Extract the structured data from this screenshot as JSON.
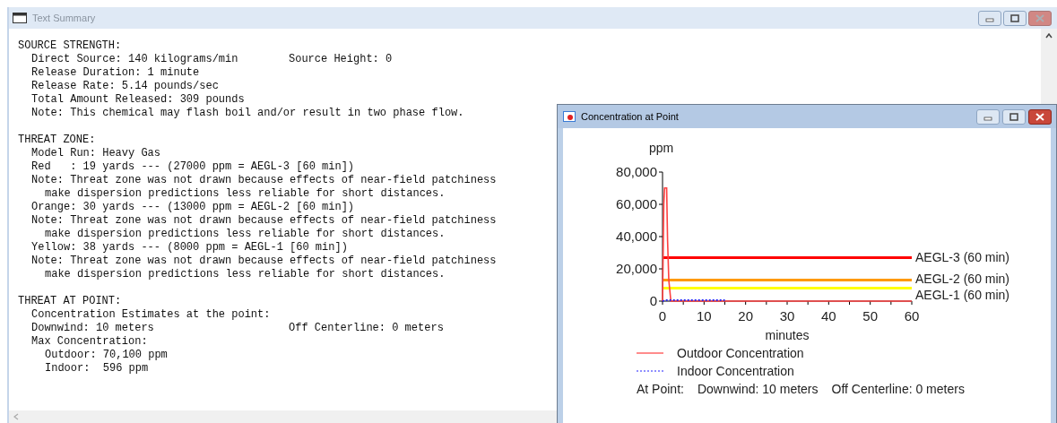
{
  "summary_window": {
    "title": "Text Summary",
    "sections": [
      {
        "heading": "SOURCE STRENGTH:",
        "items": [
          {
            "text": "Direct Source: 140 kilograms/min",
            "aside": "Source Height: 0"
          },
          {
            "text": "Release Duration: 1 minute"
          },
          {
            "text": "Release Rate: 5.14 pounds/sec"
          },
          {
            "text": "Total Amount Released: 309 pounds"
          },
          {
            "text": "Note: This chemical may flash boil and/or result in two phase flow."
          }
        ]
      },
      {
        "heading": "THREAT ZONE:",
        "items": [
          {
            "text": "Model Run: Heavy Gas"
          },
          {
            "text": "Red   : 19 yards --- (27000 ppm = AEGL-3 [60 min])"
          },
          {
            "text": "Note: Threat zone was not drawn because effects of near-field patchiness",
            "children": [
              {
                "text": "make dispersion predictions less reliable for short distances."
              }
            ]
          },
          {
            "text": "Orange: 30 yards --- (13000 ppm = AEGL-2 [60 min])"
          },
          {
            "text": "Note: Threat zone was not drawn because effects of near-field patchiness",
            "children": [
              {
                "text": "make dispersion predictions less reliable for short distances."
              }
            ]
          },
          {
            "text": "Yellow: 38 yards --- (8000 ppm = AEGL-1 [60 min])"
          },
          {
            "text": "Note: Threat zone was not drawn because effects of near-field patchiness",
            "children": [
              {
                "text": "make dispersion predictions less reliable for short distances."
              }
            ]
          }
        ]
      },
      {
        "heading": "THREAT AT POINT:",
        "items": [
          {
            "text": "Concentration Estimates at the point:"
          },
          {
            "text": "Downwind: 10 meters",
            "aside": "Off Centerline: 0 meters"
          },
          {
            "text": "Max Concentration:",
            "children": [
              {
                "text": "Outdoor: 70,100 ppm"
              },
              {
                "text": "Indoor:  596 ppm"
              }
            ]
          }
        ]
      }
    ]
  },
  "chart_window": {
    "title": "Concentration at Point",
    "chart_data": {
      "type": "line",
      "xlabel": "minutes",
      "ylabel": "ppm",
      "x": [
        0,
        0.3,
        0.5,
        1,
        1.2,
        1.5,
        2,
        15,
        60
      ],
      "series": [
        {
          "name": "Outdoor Concentration",
          "color": "#ff4040",
          "line_style": "solid",
          "values": [
            0,
            60000,
            70100,
            70100,
            38000,
            13000,
            0,
            0,
            0
          ]
        },
        {
          "name": "Indoor Concentration",
          "color": "#2020ff",
          "line_style": "dashed",
          "values": [
            0,
            300,
            600,
            600,
            600,
            600,
            600,
            600,
            null
          ]
        }
      ],
      "xlim": [
        0,
        60
      ],
      "ylim": [
        0,
        80000
      ],
      "xticks": [
        0,
        10,
        20,
        30,
        40,
        50,
        60
      ],
      "yticks": [
        {
          "value": 0,
          "label": "0"
        },
        {
          "value": 20000,
          "label": "20,000"
        },
        {
          "value": 40000,
          "label": "40,000"
        },
        {
          "value": 60000,
          "label": "60,000"
        },
        {
          "value": 80000,
          "label": "80,000"
        }
      ],
      "ref_lines": [
        {
          "axis": "y",
          "value": 8000,
          "label": "AEGL-1 (60 min)",
          "color": "#ffff00"
        },
        {
          "axis": "y",
          "value": 13000,
          "label": "AEGL-2 (60 min)",
          "color": "#ff9900"
        },
        {
          "axis": "y",
          "value": 27000,
          "label": "AEGL-3 (60 min)",
          "color": "#ff0000"
        }
      ]
    },
    "point_info": {
      "label": "At Point:",
      "downwind": "Downwind: 10 meters",
      "off_centerline": "Off Centerline: 0 meters"
    }
  }
}
